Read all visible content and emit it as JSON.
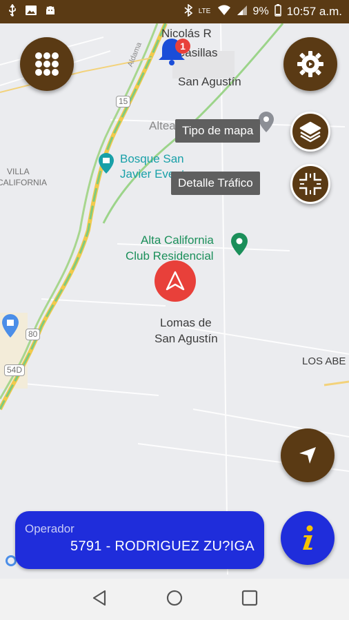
{
  "status_bar": {
    "battery": "9%",
    "time": "10:57 a.m.",
    "network": "LTE"
  },
  "map": {
    "labels": {
      "nicolas": "Nicolás R",
      "casillas": "Casillas",
      "san_agustin": "San Agustín",
      "altea": "Altea Residencial",
      "bosque_line1": "Bosque San",
      "bosque_line2": "Javier Eventos",
      "villa_line1": "VILLA",
      "villa_line2": "CALIFORNIA",
      "alta_line1": "Alta California",
      "alta_line2": "Club Residencial",
      "lomas_line1": "Lomas de",
      "lomas_line2": "San Agustín",
      "los_abe": "LOS ABE",
      "aldama": "Aldama"
    },
    "shields": {
      "s15": "15",
      "s80": "80",
      "s54": "54D"
    }
  },
  "notification": {
    "count": "1"
  },
  "controls": {
    "map_type_label": "Tipo de mapa",
    "traffic_label": "Detalle Tráfico"
  },
  "operator": {
    "label": "Operador",
    "value": "5791 - RODRIGUEZ ZU?IGA"
  },
  "colors": {
    "brand_brown": "#5a3a14",
    "operator_blue": "#1f2ddb",
    "location_red": "#e8403a",
    "info_yellow": "#f6c300"
  }
}
